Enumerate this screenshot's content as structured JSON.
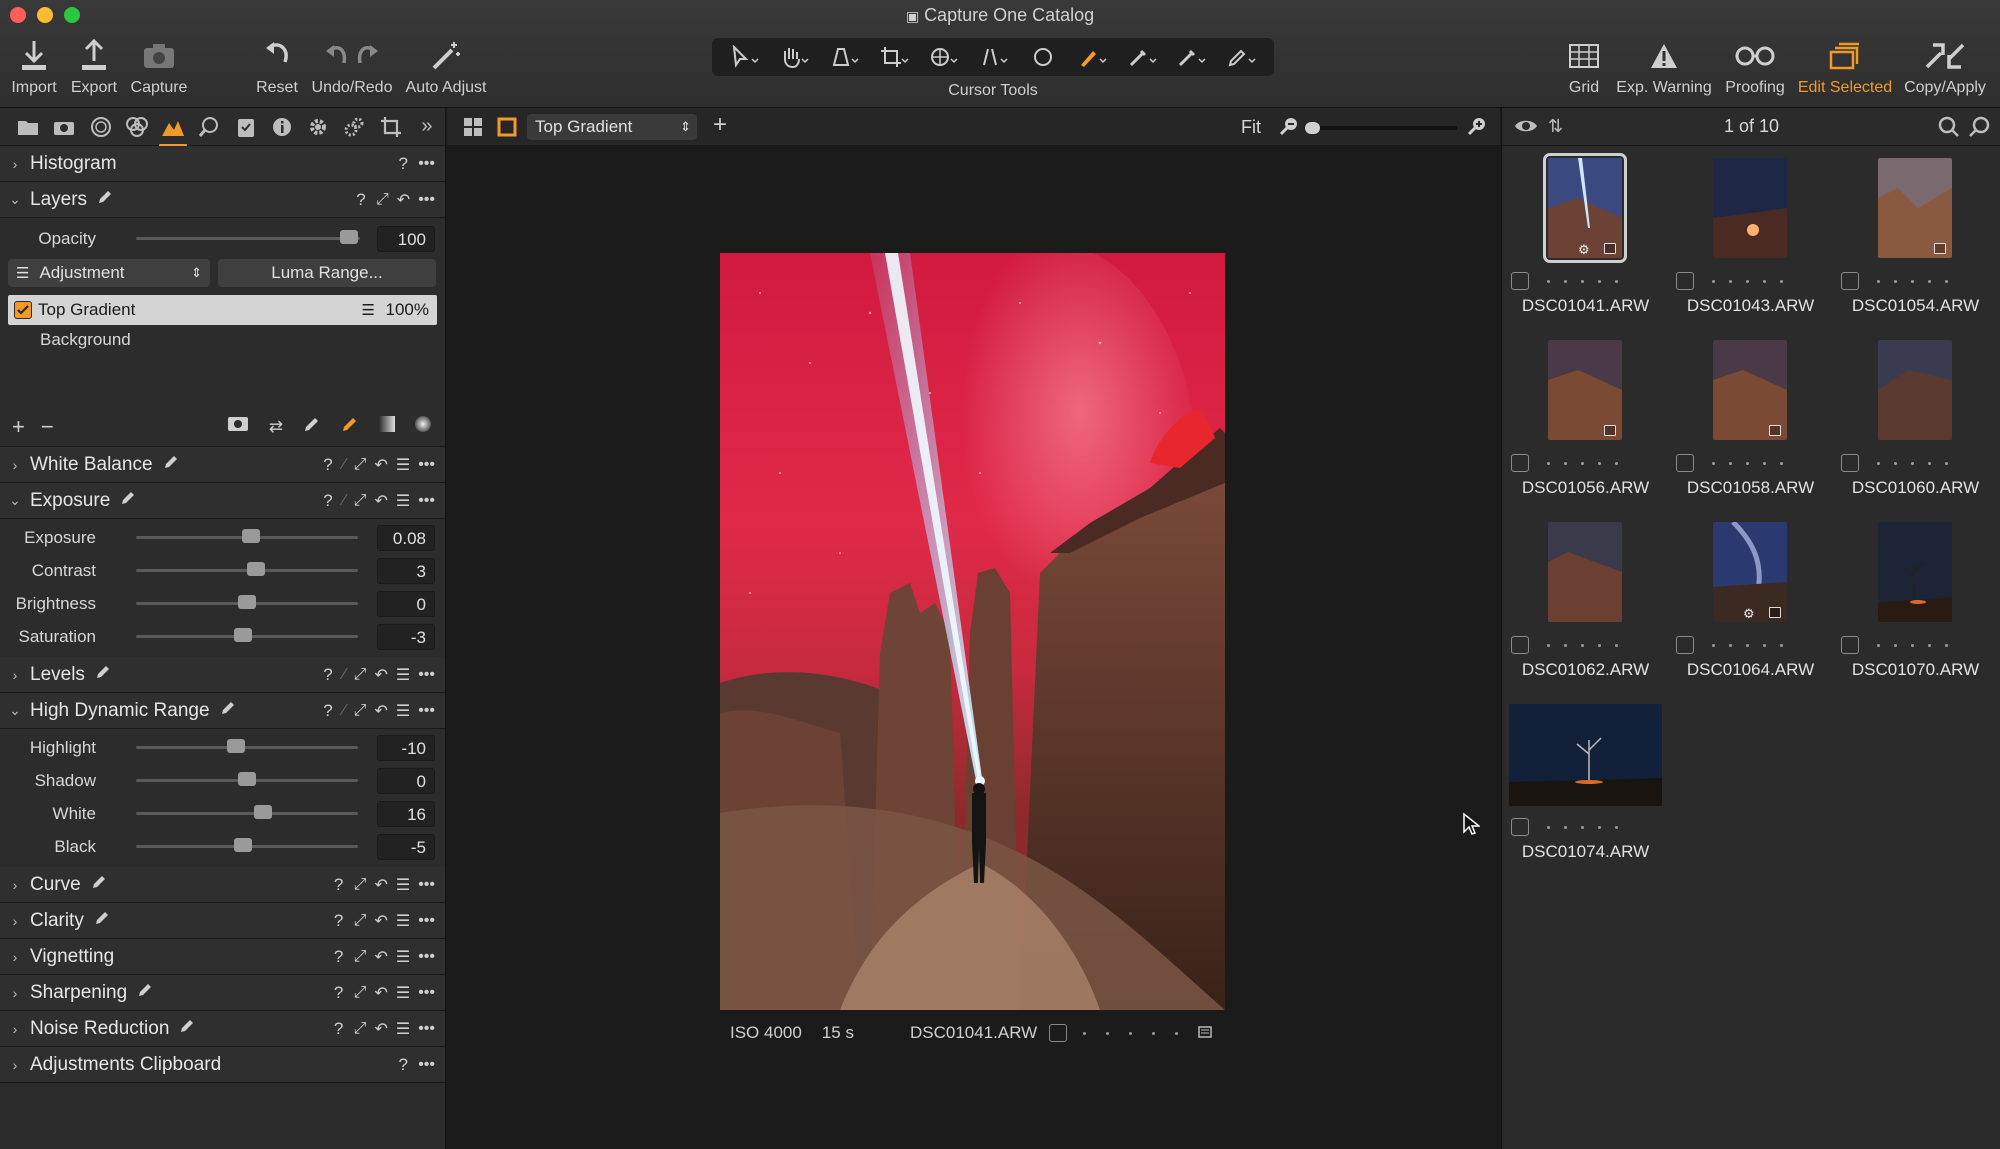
{
  "window": {
    "title": "Capture One Catalog"
  },
  "toolbar": {
    "import": "Import",
    "export": "Export",
    "capture": "Capture",
    "reset": "Reset",
    "undo_redo": "Undo/Redo",
    "auto_adjust": "Auto Adjust",
    "cursor_tools": "Cursor Tools",
    "grid": "Grid",
    "exp_warning": "Exp. Warning",
    "proofing": "Proofing",
    "edit_selected": "Edit Selected",
    "copy_apply": "Copy/Apply"
  },
  "colors": {
    "accent": "#f19a2a",
    "panel": "#2c2c2c",
    "viewer_bg": "#1b1b1b"
  },
  "left": {
    "histogram": {
      "title": "Histogram"
    },
    "layers": {
      "title": "Layers",
      "opacity_label": "Opacity",
      "opacity_value": "100",
      "opacity_level": 0.95,
      "mode": "Adjustment",
      "luma_button": "Luma Range...",
      "items": [
        {
          "name": "Top Gradient",
          "opacity": "100%"
        },
        {
          "name": "Background"
        }
      ]
    },
    "white_balance": {
      "title": "White Balance"
    },
    "exposure": {
      "title": "Exposure",
      "sliders": [
        {
          "label": "Exposure",
          "value": "0.08",
          "level": 0.52
        },
        {
          "label": "Contrast",
          "value": "3",
          "level": 0.54
        },
        {
          "label": "Brightness",
          "value": "0",
          "level": 0.5
        },
        {
          "label": "Saturation",
          "value": "-3",
          "level": 0.48
        }
      ]
    },
    "levels": {
      "title": "Levels"
    },
    "hdr": {
      "title": "High Dynamic Range",
      "sliders": [
        {
          "label": "Highlight",
          "value": "-10",
          "level": 0.45
        },
        {
          "label": "Shadow",
          "value": "0",
          "level": 0.5
        },
        {
          "label": "White",
          "value": "16",
          "level": 0.57
        },
        {
          "label": "Black",
          "value": "-5",
          "level": 0.48
        }
      ]
    },
    "curve": {
      "title": "Curve"
    },
    "clarity": {
      "title": "Clarity"
    },
    "vignetting": {
      "title": "Vignetting"
    },
    "sharpening": {
      "title": "Sharpening"
    },
    "noise_reduction": {
      "title": "Noise Reduction"
    },
    "adjustments_clipboard": {
      "title": "Adjustments Clipboard"
    }
  },
  "viewer": {
    "layer_select": "Top Gradient",
    "zoom_label": "Fit",
    "zoom_level": 0.1,
    "info": {
      "iso": "ISO 4000",
      "shutter": "15 s",
      "filename": "DSC01041.ARW"
    }
  },
  "browser": {
    "counter": "1 of 10",
    "items": [
      {
        "name": "DSC01041.ARW",
        "selected": true
      },
      {
        "name": "DSC01043.ARW"
      },
      {
        "name": "DSC01054.ARW"
      },
      {
        "name": "DSC01056.ARW"
      },
      {
        "name": "DSC01058.ARW"
      },
      {
        "name": "DSC01060.ARW"
      },
      {
        "name": "DSC01062.ARW"
      },
      {
        "name": "DSC01064.ARW"
      },
      {
        "name": "DSC01070.ARW"
      },
      {
        "name": "DSC01074.ARW"
      }
    ]
  }
}
